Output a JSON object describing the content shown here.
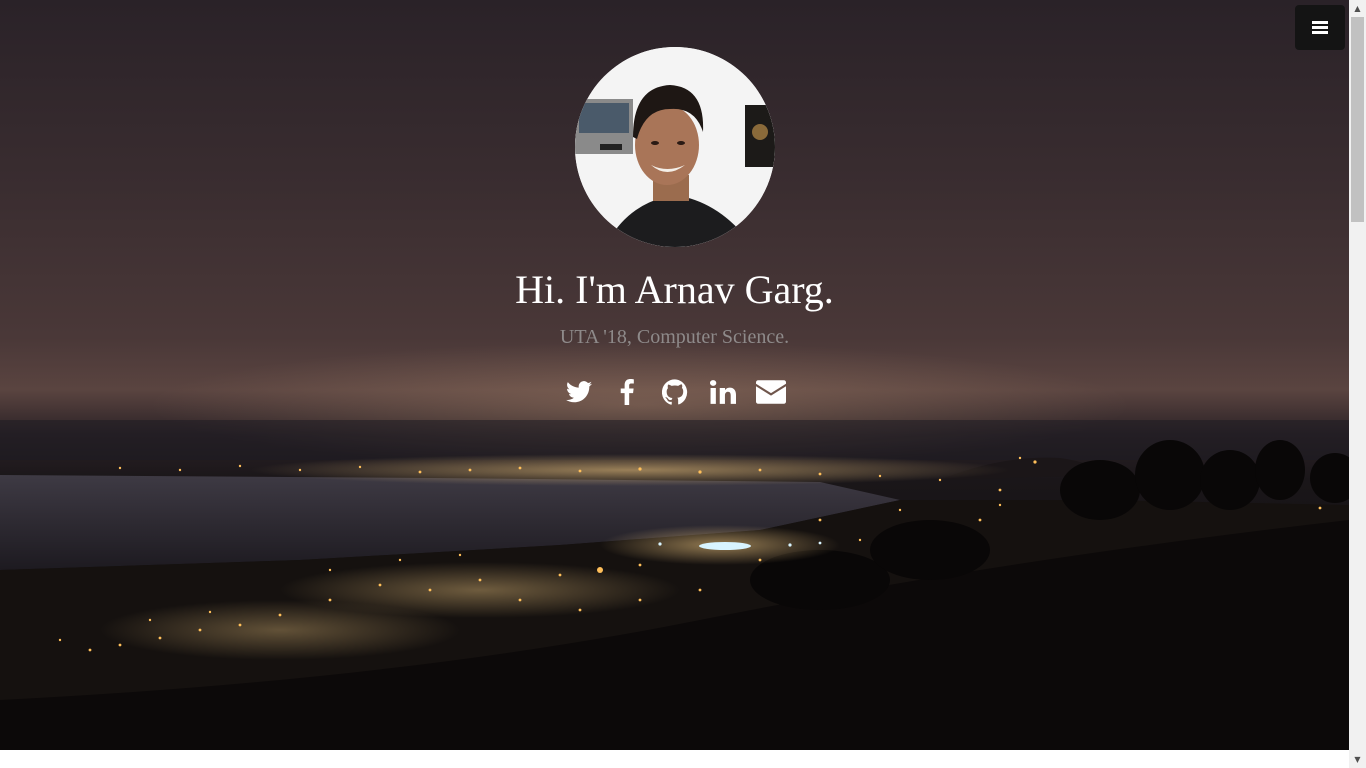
{
  "profile": {
    "heading": "Hi. I'm Arnav Garg.",
    "tagline": "UTA '18, Computer Science."
  },
  "social_links": [
    {
      "name": "twitter",
      "icon": "twitter-icon"
    },
    {
      "name": "facebook",
      "icon": "facebook-icon"
    },
    {
      "name": "github",
      "icon": "github-icon"
    },
    {
      "name": "linkedin",
      "icon": "linkedin-icon"
    },
    {
      "name": "email",
      "icon": "envelope-icon"
    }
  ],
  "menu": {
    "icon": "hamburger-menu-icon"
  },
  "colors": {
    "heading": "#ffffff",
    "tagline": "#8e8a8a",
    "menu_button_bg": "#141414",
    "city_lights": "#ffb24a"
  }
}
